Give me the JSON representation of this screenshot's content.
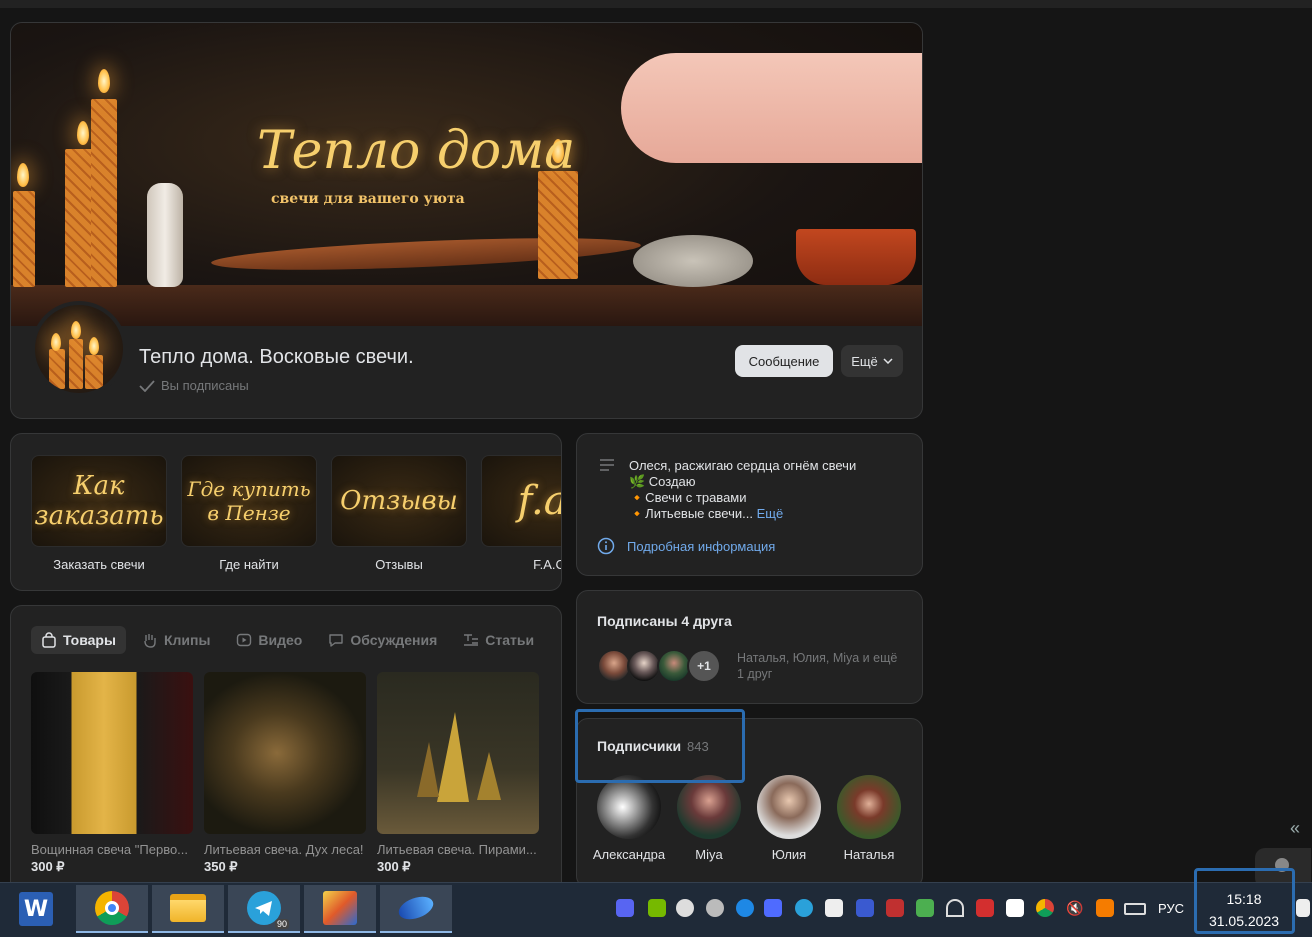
{
  "cover": {
    "title": "Тепло дома",
    "subtitle": "свечи для вашего уюта"
  },
  "group": {
    "title": "Тепло дома. Восковые свечи.",
    "subscribed_label": "Вы подписаны",
    "message_button": "Сообщение",
    "more_button": "Ещё"
  },
  "links": [
    {
      "image_text": "Как заказать",
      "label": "Заказать свечи"
    },
    {
      "image_text": "Где купить в Пензе",
      "label": "Где найти"
    },
    {
      "image_text": "Отзывы",
      "label": "Отзывы"
    },
    {
      "image_text": "f.a.",
      "label": "F.A.C"
    }
  ],
  "tabs": [
    {
      "label": "Товары",
      "icon": "bag-icon",
      "active": true
    },
    {
      "label": "Клипы",
      "icon": "clips-icon"
    },
    {
      "label": "Видео",
      "icon": "video-icon"
    },
    {
      "label": "Обсуждения",
      "icon": "discussion-icon"
    },
    {
      "label": "Статьи",
      "icon": "articles-icon"
    }
  ],
  "products": [
    {
      "name": "Вощинная свеча \"Перво...",
      "price": "300 ₽"
    },
    {
      "name": "Литьевая свеча. Дух леса!",
      "price": "350 ₽"
    },
    {
      "name": "Литьевая свеча. Пирами...",
      "price": "300 ₽"
    }
  ],
  "info": {
    "line1": "Олеся, расжигаю сердца огнём свечи",
    "line2": "🌿 Создаю",
    "line3": "🔸Свечи с травами",
    "line4": "🔸Литьевые свечи...",
    "more_link": "Ещё",
    "details_link": "Подробная информация"
  },
  "friends": {
    "title": "Подписаны 4 друга",
    "extra_count": "+1",
    "names": "Наталья, Юлия, Miya и ещё 1 друг"
  },
  "subscribers": {
    "title": "Подписчики",
    "count": "843",
    "people": [
      {
        "name": "Александра"
      },
      {
        "name": "Miya"
      },
      {
        "name": "Юлия"
      },
      {
        "name": "Наталья"
      }
    ]
  },
  "taskbar": {
    "apps": [
      "word-icon",
      "chrome-icon",
      "file-explorer-icon",
      "telegram-icon",
      "video-editor-icon",
      "app-icon"
    ],
    "telegram_badge": "90",
    "language": "РУС",
    "time": "15:18",
    "date": "31.05.2023"
  },
  "colors": {
    "background": "#151515",
    "card": "#222222",
    "link": "#71aaeb",
    "highlight_box": "#2b6cb0",
    "taskbar": "#1f2a38"
  }
}
